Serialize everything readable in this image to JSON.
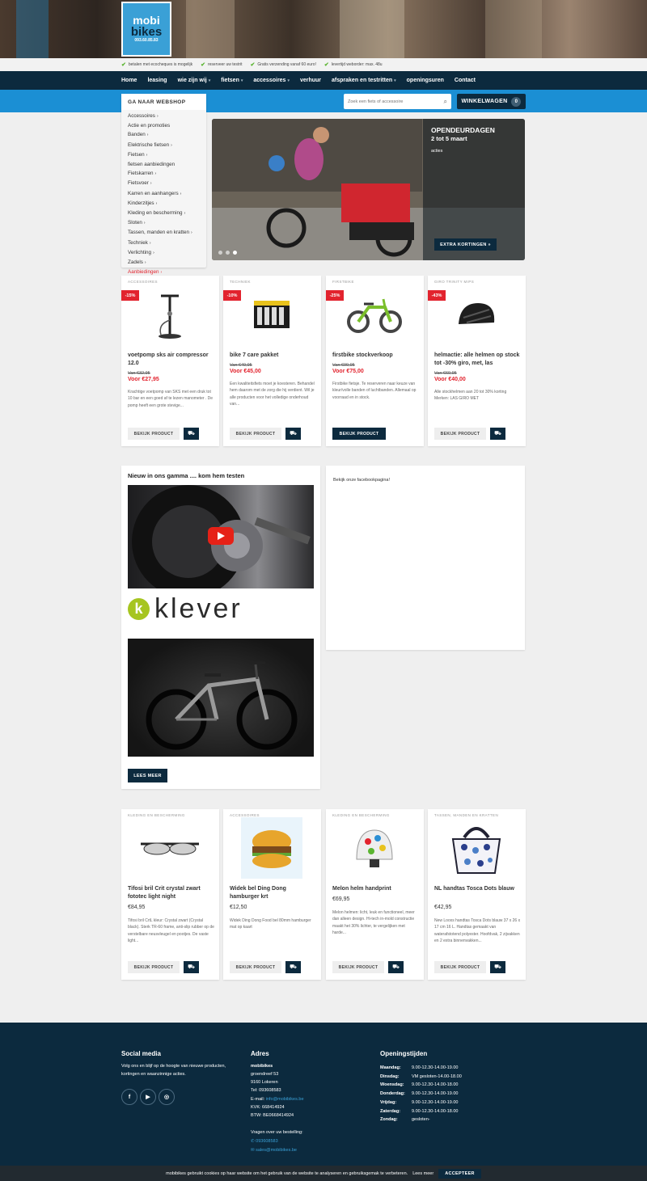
{
  "logo": {
    "line1": "mobi",
    "line2": "bikes",
    "line3": "093.60.85.83"
  },
  "usp": [
    "betalen met ecocheques is mogelijk",
    "reserveer uw testrit",
    "Gratis verzending vanaf 60 euro!",
    "levertijd weborder: max. 48u"
  ],
  "nav": [
    {
      "label": "Home",
      "caret": false
    },
    {
      "label": "leasing",
      "caret": false
    },
    {
      "label": "wie zijn wij",
      "caret": true
    },
    {
      "label": "fietsen",
      "caret": true
    },
    {
      "label": "accessoires",
      "caret": true
    },
    {
      "label": "verhuur",
      "caret": false
    },
    {
      "label": "afspraken en testritten",
      "caret": true
    },
    {
      "label": "openingsuren",
      "caret": false
    },
    {
      "label": "Contact",
      "caret": false
    }
  ],
  "search": {
    "placeholder": "Zoek een fiets of accessoire"
  },
  "cart": {
    "label": "WINKELWAGEN",
    "count": "0"
  },
  "sidemenu": {
    "heading": "GA NAAR WEBSHOP",
    "items": [
      {
        "label": "Accessoires",
        "arrow": true,
        "red": false
      },
      {
        "label": "Actie en promoties",
        "arrow": false,
        "red": false
      },
      {
        "label": "Banden",
        "arrow": true,
        "red": false
      },
      {
        "label": "Elektrische fietsen",
        "arrow": true,
        "red": false
      },
      {
        "label": "Fietsen",
        "arrow": true,
        "red": false
      },
      {
        "label": "fietsen aanbiedingen",
        "arrow": false,
        "red": false
      },
      {
        "label": "Fietskarren",
        "arrow": true,
        "red": false
      },
      {
        "label": "Fietsvoer",
        "arrow": true,
        "red": false
      },
      {
        "label": "Karren en aanhangers",
        "arrow": true,
        "red": false
      },
      {
        "label": "Kinderzitjes",
        "arrow": true,
        "red": false
      },
      {
        "label": "Kleding en bescherming",
        "arrow": true,
        "red": false
      },
      {
        "label": "Sloten",
        "arrow": true,
        "red": false
      },
      {
        "label": "Tassen, manden en kratten",
        "arrow": true,
        "red": false
      },
      {
        "label": "Techniek",
        "arrow": true,
        "red": false
      },
      {
        "label": "Verlichting",
        "arrow": true,
        "red": false
      },
      {
        "label": "Zadels",
        "arrow": true,
        "red": false
      },
      {
        "label": "Aanbiedingen",
        "arrow": true,
        "red": true
      }
    ]
  },
  "slider": {
    "title": "OPENDEURDAGEN",
    "subtitle": "2 tot 5 maart",
    "tag": "acties",
    "button": "EXTRA KORTINGEN »"
  },
  "products_top": [
    {
      "cat": "ACCESSOIRES",
      "disc": "-15%",
      "name": "voetpomp sks air compressor 12.0",
      "old": "Van €32,95",
      "new": "Voor €27,95",
      "desc": "Krachtige voetpomp van SKS met een druk tot 10 bar en een goed af te lezen manometer . De pomp heeft een grote stevige...",
      "btn": "BEKIJK PRODUCT",
      "icon": "pump-icon"
    },
    {
      "cat": "TECHNIEK",
      "disc": "-10%",
      "name": "bike 7 care pakket",
      "old": "Van €49,95",
      "new": "Voor €45,00",
      "desc": "Een kwaliteitsfiets moet je koesteren. Behandel hem daarom met de zorg die hij verdient. Wil je alle producten voor het volledige onderhoud van...",
      "btn": "BEKIJK PRODUCT",
      "icon": "care-kit-icon"
    },
    {
      "cat": "FIRSTBIKE",
      "disc": "-25%",
      "name": "firstbike stockverkoop",
      "old": "Van €99,95",
      "new": "Voor €75,00",
      "desc": "Firstbike fietsje. Te reserveren naar keuze van kleur/volle banden of luchtbanden. Allemaal op voorraad en in stock.",
      "btn": "BEKIJK PRODUCT",
      "icon": "balance-bike-icon"
    },
    {
      "cat": "GIRO TRINITY MIPS",
      "disc": "-43%",
      "name": "helmactie: alle helmen op stock tot -30% giro, met, las",
      "old": "Van €69,95",
      "new": "Voor €40,00",
      "desc": "Alle stockhelmen aan 20 tot 30% korting Merken: LAS GIRO MET",
      "btn": "BEKIJK PRODUCT",
      "icon": "helmet-icon"
    }
  ],
  "media": {
    "title": "Nieuw in ons gamma .... kom hem testen",
    "brand": "klever",
    "button": "LEES MEER"
  },
  "facebook": {
    "text": "Bekijk onze facebookpagina!"
  },
  "products_bottom": [
    {
      "cat": "KLEDING EN BESCHERMING",
      "name": "Tifosi bril Crit crystal zwart fototec light night",
      "price": "€84,95",
      "desc": "Tifosi bril CrtL kleur: Crystal zwart (Crystal black). Sterk TR-60 frame, anti-slip rubber op de verstelbare neusvleugel en pootjes. De vaste light...",
      "btn": "BEKIJK PRODUCT",
      "icon": "glasses-icon"
    },
    {
      "cat": "ACCESSOIRES",
      "name": "Widek bel Ding Dong hamburger krt",
      "price": "€12,50",
      "desc": "Widek Ding Dong Food bel 80mm hamburger mat op kaart",
      "btn": "BEKIJK PRODUCT",
      "icon": "bell-icon"
    },
    {
      "cat": "KLEDING EN BESCHERMING",
      "name": "Melon helm handprint",
      "price": "€69,95",
      "desc": "Melon helmen: licht, leuk en functioneel, meer dan alleen design. Hi-tech in-mold constructie maakt het 30% lichter, te vergelijken met harde...",
      "btn": "BEKIJK PRODUCT",
      "icon": "kids-helmet-icon"
    },
    {
      "cat": "TASSEN, MANDEN EN KRATTEN",
      "name": "NL handtas Tosca Dots blauw",
      "price": "€42,95",
      "desc": "New Looxs handtas Tosca Dots blauw 37 x 26 x 17 cm 16 L. Handtas gemaakt van waterafstotend polyester. Hoofdvak, 2 zijvakken en 2 extra binnenvakken...",
      "btn": "BEKIJK PRODUCT",
      "icon": "handbag-icon"
    }
  ],
  "footer": {
    "social": {
      "title": "Social media",
      "text": "Volg ons en blijf op de hoogte van nieuwe producten, kortingen en waanzinnige acties."
    },
    "address": {
      "title": "Adres",
      "name": "mobibikes",
      "lines": [
        "groendreef 53",
        "9160 Lokeren",
        "Tel: 093608583"
      ],
      "email_label": "E-mail:",
      "email": "info@mobibikes.be",
      "kvk": "KVK: 668414924",
      "btw": "BTW: BE0668414924",
      "question": "Vragen over uw bestelling:",
      "phone": "093608583",
      "mail2": "sales@mobibikes.be"
    },
    "hours": {
      "title": "Openingstijden",
      "rows": [
        {
          "day": "Maandag:",
          "time": "9.00-12.30-14.00-19.00"
        },
        {
          "day": "Dinsdag:",
          "time": "VM gesloten-14.00-18.00"
        },
        {
          "day": "Woensdag:",
          "time": "9.00-12.30-14.00-18.00"
        },
        {
          "day": "Donderdag:",
          "time": "9.00-12.30-14.00-19.00"
        },
        {
          "day": "Vrijdag:",
          "time": "9.00-12.30-14.00-19.00"
        },
        {
          "day": "Zaterdag:",
          "time": "9.00-12.30-14.00-18.00"
        },
        {
          "day": "Zondag:",
          "time": "gesloten-"
        }
      ]
    }
  },
  "cookie": {
    "text": "mobibikes gebruikt cookies op haar website om het gebruik van de website te analyseren en gebruiksgemak te verbeteren.",
    "more": "Lees meer",
    "accept": "ACCEPTEER"
  },
  "colors": {
    "navy": "#0c2a3e",
    "blue": "#1b8fd4",
    "red": "#e2232e",
    "green": "#5bb531"
  }
}
